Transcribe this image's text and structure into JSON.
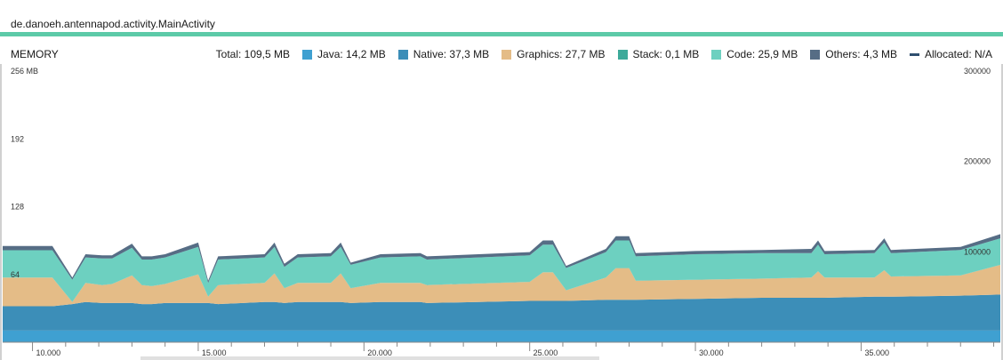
{
  "window": {
    "title": "de.danoeh.antennapod.activity.MainActivity"
  },
  "monitor": {
    "label": "MEMORY"
  },
  "legend": {
    "total": "Total: 109,5 MB",
    "items": [
      {
        "label": "Java: 14,2 MB",
        "color": "#3fa0d1"
      },
      {
        "label": "Native: 37,3 MB",
        "color": "#3c8eb8"
      },
      {
        "label": "Graphics: 27,7 MB",
        "color": "#e4bc87"
      },
      {
        "label": "Stack: 0,1 MB",
        "color": "#3daa9a"
      },
      {
        "label": "Code: 25,9 MB",
        "color": "#6dd0c0"
      },
      {
        "label": "Others: 4,3 MB",
        "color": "#566d85"
      }
    ],
    "allocated": "Allocated: N/A"
  },
  "chart_data": {
    "type": "area",
    "stacked": true,
    "y_left": {
      "ticks": [
        "256 MB",
        "192",
        "128",
        "64"
      ],
      "values": [
        256,
        192,
        128,
        64
      ],
      "range": [
        0,
        256
      ]
    },
    "y_right": {
      "ticks": [
        "300000",
        "200000",
        "100000"
      ],
      "values": [
        300000,
        200000,
        100000
      ],
      "range": [
        0,
        300000
      ]
    },
    "x_axis": {
      "ticks": [
        "10.000",
        "15.000",
        "20.000",
        "25.000",
        "30.000",
        "35.000"
      ],
      "values": [
        10,
        15,
        20,
        25,
        30,
        35
      ],
      "range": [
        9.1,
        39.2
      ]
    },
    "x": [
      9.1,
      10.6,
      11.2,
      11.6,
      12.1,
      12.4,
      13.0,
      13.3,
      13.6,
      14.0,
      15.0,
      15.3,
      15.6,
      17.0,
      17.3,
      17.6,
      18.0,
      19.0,
      19.3,
      19.6,
      20.5,
      21.7,
      21.9,
      25.0,
      25.4,
      25.7,
      26.1,
      27.3,
      27.6,
      28.0,
      28.2,
      30.0,
      32.0,
      33.5,
      33.7,
      33.9,
      35.4,
      35.7,
      35.9,
      38.0,
      39.2
    ],
    "series": [
      {
        "name": "Java",
        "values": [
          11,
          11,
          11,
          11,
          11,
          11,
          11,
          11,
          11,
          11,
          11,
          11,
          11,
          11,
          11,
          11,
          11,
          11,
          11,
          11,
          11,
          11,
          11,
          11,
          11,
          11,
          11,
          11,
          11,
          11,
          11,
          11,
          11,
          11,
          11,
          11,
          11,
          11,
          11,
          11,
          11
        ]
      },
      {
        "name": "Native",
        "values": [
          23,
          23,
          25,
          27,
          26,
          26,
          26,
          25,
          25,
          26,
          26,
          26,
          25,
          27,
          27,
          26,
          27,
          27,
          27,
          26,
          27,
          27,
          26,
          28,
          28,
          28,
          28,
          29,
          29,
          29,
          29,
          30,
          31,
          31,
          31,
          31,
          32,
          32,
          32,
          33,
          34
        ]
      },
      {
        "name": "Graphics",
        "values": [
          27,
          27,
          2,
          18,
          17,
          18,
          26,
          18,
          17,
          18,
          27,
          6,
          18,
          18,
          27,
          14,
          18,
          18,
          27,
          14,
          18,
          18,
          17,
          18,
          27,
          27,
          10,
          21,
          30,
          30,
          18,
          18,
          18,
          19,
          25,
          19,
          18,
          25,
          19,
          19,
          28
        ]
      },
      {
        "name": "Stack",
        "values": [
          0.1,
          0.1,
          0.1,
          0.1,
          0.1,
          0.1,
          0.1,
          0.1,
          0.1,
          0.1,
          0.1,
          0.1,
          0.1,
          0.1,
          0.1,
          0.1,
          0.1,
          0.1,
          0.1,
          0.1,
          0.1,
          0.1,
          0.1,
          0.1,
          0.1,
          0.1,
          0.1,
          0.1,
          0.1,
          0.1,
          0.1,
          0.1,
          0.1,
          0.1,
          0.1,
          0.1,
          0.1,
          0.1,
          0.1,
          0.1,
          0.1
        ]
      },
      {
        "name": "Code",
        "values": [
          25.8,
          25.8,
          21,
          24,
          25,
          24,
          26,
          24,
          25,
          25,
          26,
          13,
          24,
          24,
          25,
          20,
          24,
          25,
          25,
          22,
          24,
          25,
          24,
          25,
          26,
          26,
          21,
          24,
          26,
          26,
          23,
          24,
          24,
          23,
          25,
          22,
          23,
          26,
          22,
          24,
          25
        ]
      },
      {
        "name": "Others",
        "values": [
          4,
          4,
          2,
          3,
          3,
          3,
          4,
          3,
          3,
          3,
          4,
          2,
          3,
          3,
          4,
          3,
          3,
          3,
          4,
          2,
          3,
          3,
          3,
          3,
          4,
          4,
          2,
          3,
          4,
          4,
          3,
          3,
          3,
          4,
          4,
          3,
          3,
          4,
          3,
          3,
          4
        ]
      }
    ]
  }
}
